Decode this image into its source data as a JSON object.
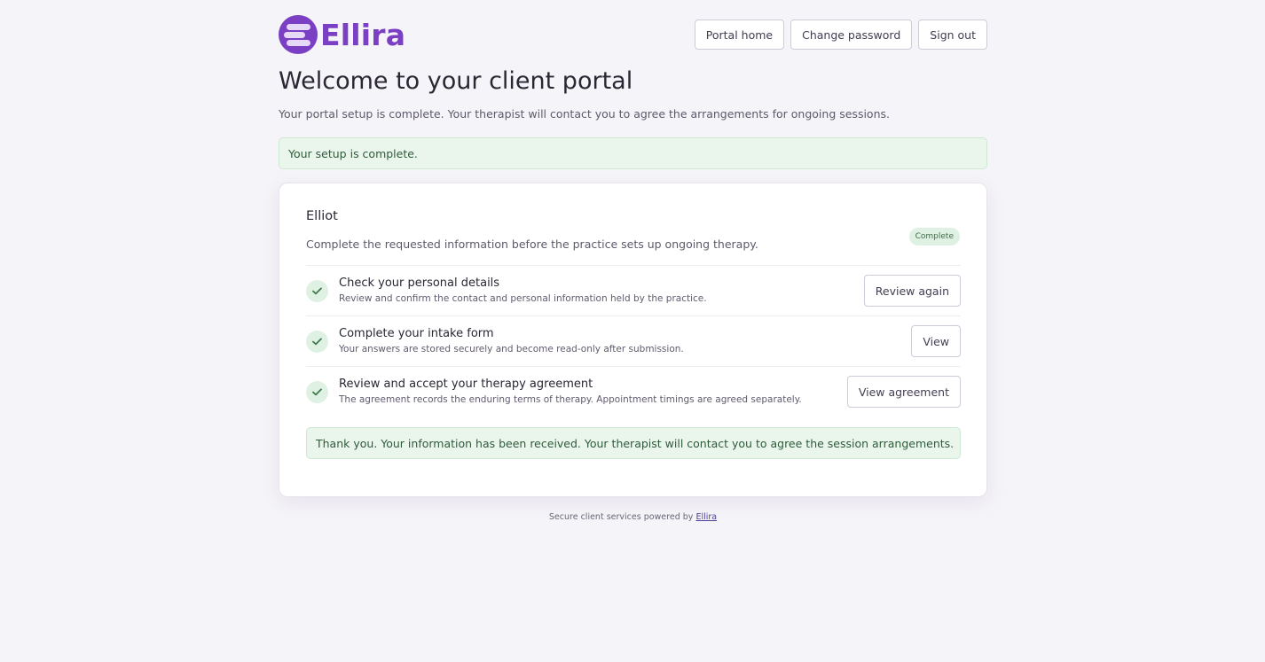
{
  "brand": {
    "name": "Ellira",
    "accent": "#7b3fc4"
  },
  "nav": {
    "portal_home": "Portal home",
    "change_password": "Change password",
    "sign_out": "Sign out"
  },
  "page": {
    "title": "Welcome to your client portal",
    "subtitle": "Your portal setup is complete. Your therapist will contact you to agree the arrangements for ongoing sessions."
  },
  "setup_alert": "Your setup is complete.",
  "card": {
    "client_name": "Elliot",
    "description": "Complete the requested information before the practice sets up ongoing therapy.",
    "status_badge": "Complete",
    "tasks": [
      {
        "title": "Check your personal details",
        "subtitle": "Review and confirm the contact and personal information held by the practice.",
        "action": "Review again",
        "done": true
      },
      {
        "title": "Complete your intake form",
        "subtitle": "Your answers are stored securely and become read-only after submission.",
        "action": "View",
        "done": true
      },
      {
        "title": "Review and accept your therapy agreement",
        "subtitle": "The agreement records the enduring terms of therapy. Appointment timings are agreed separately.",
        "action": "View agreement",
        "done": true
      }
    ],
    "notice": "Thank you. Your information has been received. Your therapist will contact you to agree the session arrangements."
  },
  "footer": {
    "text": "Secure client services powered by",
    "link": "Ellira"
  },
  "colors": {
    "background": "#f5f4f8",
    "success_bg": "#eaf6ec",
    "success_text": "#2f5a3a",
    "check_green": "#3d7a4c"
  }
}
